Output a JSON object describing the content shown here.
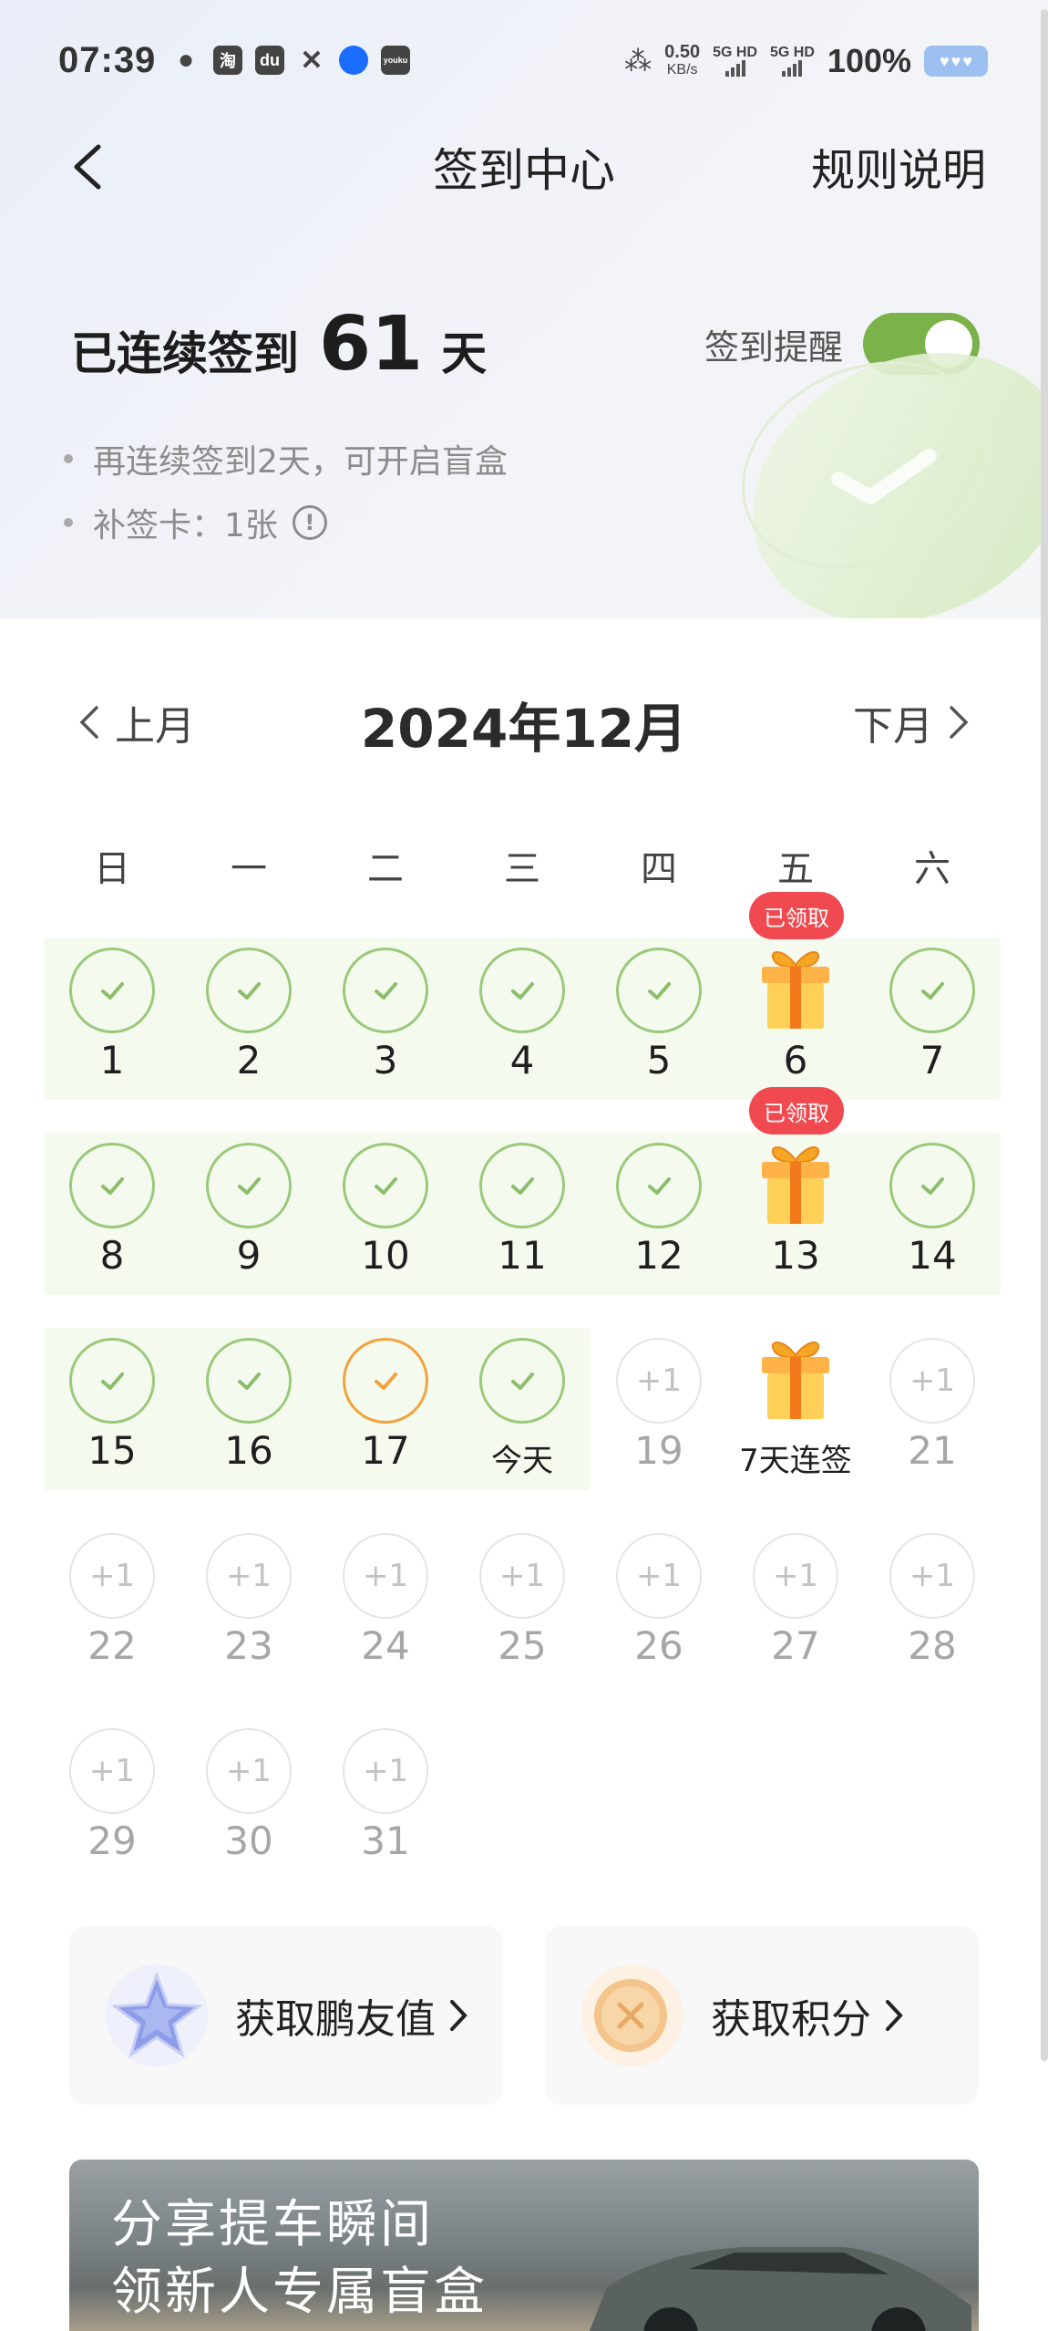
{
  "status_bar": {
    "time": "07:39",
    "net_speed": "0.50",
    "net_unit": "KB/s",
    "sim1": "5G HD",
    "sim2": "5G HD",
    "battery": "100%",
    "apps": [
      "wechat-icon",
      "taobao-icon",
      "dewu-icon",
      "xianyu-icon",
      "alipay-icon",
      "youku-icon"
    ]
  },
  "header": {
    "title": "签到中心",
    "rules": "规则说明"
  },
  "streak": {
    "prefix": "已连续签到",
    "days": "61",
    "suffix": "天"
  },
  "reminder": {
    "label": "签到提醒",
    "enabled": true
  },
  "info": {
    "line1": "再连续签到2天，可开启盲盒",
    "line2": "补签卡：1张",
    "info_icon": "!"
  },
  "calendar": {
    "prev": "上月",
    "next": "下月",
    "month": "2024年12月",
    "weekdays": [
      "日",
      "一",
      "二",
      "三",
      "四",
      "五",
      "六"
    ],
    "claimed_badge": "已领取",
    "plus_label": "+1",
    "today_label": "今天",
    "gift_label": "7天连签",
    "colors": {
      "check_green": "#9bc97a",
      "check_orange": "#f0a33b",
      "row_bg": "#f5faef",
      "badge_red": "#f0494f"
    }
  },
  "quick_links": {
    "pengyou": "获取鹏友值",
    "points": "获取积分"
  },
  "banner": {
    "line1": "分享提车瞬间",
    "line2": "领新人专属盲盒"
  }
}
